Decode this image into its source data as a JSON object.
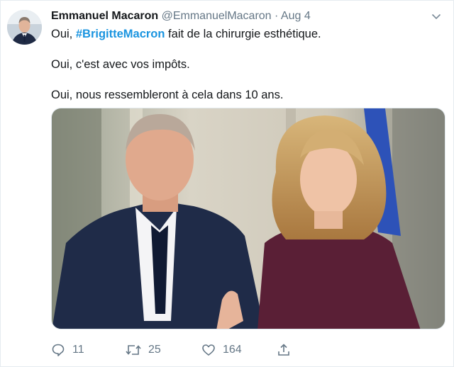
{
  "tweet": {
    "author_name": "Emmanuel Macaron",
    "author_handle": "@EmmanuelMacaron",
    "separator": "·",
    "date": "Aug 4",
    "line1_prefix": "Oui, ",
    "hashtag": "#BrigitteMacron",
    "line1_suffix": " fait de la chirurgie esthétique.",
    "line2": "Oui, c'est avec vos impôts.",
    "line3": "Oui, nous ressembleront à cela dans 10 ans."
  },
  "actions": {
    "reply_count": "11",
    "retweet_count": "25",
    "like_count": "164"
  },
  "icons": [
    "reply-icon",
    "retweet-icon",
    "like-icon",
    "share-icon",
    "chevron-down-icon"
  ],
  "colors": {
    "link": "#1b95e0",
    "muted": "#657786",
    "text": "#14171a"
  }
}
